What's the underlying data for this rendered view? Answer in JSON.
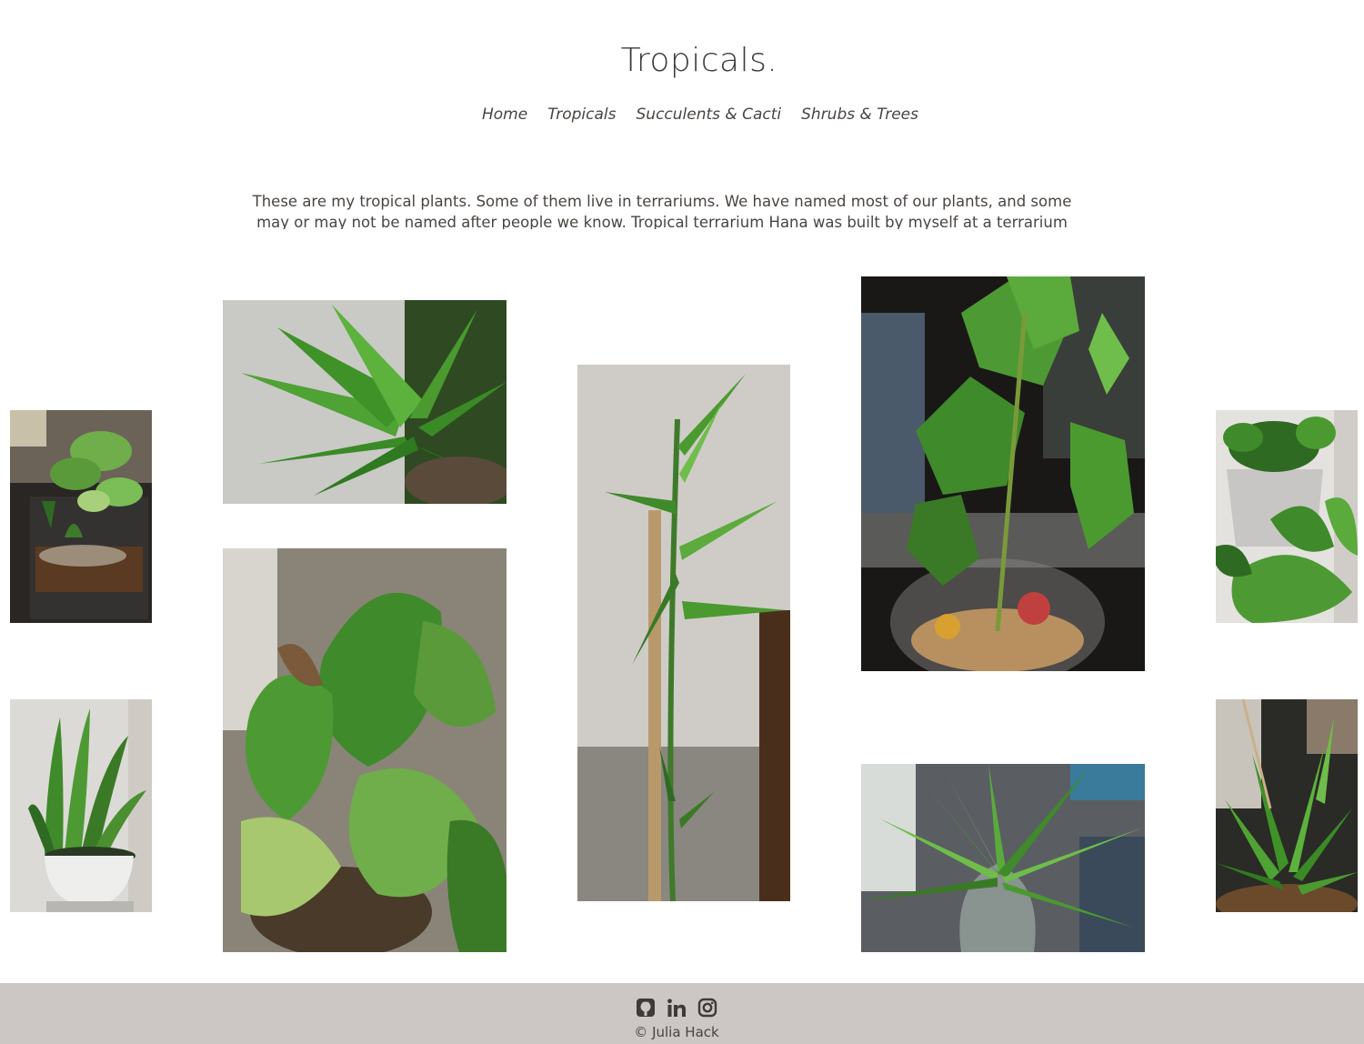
{
  "site": {
    "title": "Tropicals."
  },
  "nav": {
    "items": [
      {
        "label": "Home"
      },
      {
        "label": "Tropicals"
      },
      {
        "label": "Succulents & Cacti"
      },
      {
        "label": "Shrubs & Trees"
      }
    ]
  },
  "intro": {
    "text": "These are my tropical plants. Some of them live in terrariums. We have named most of our plants, and some may or may not be named after people we know. Tropical terrarium Hana was built by myself at a terrarium workshop."
  },
  "gallery": {
    "photos": [
      {
        "subject": "terrarium-with-plants"
      },
      {
        "subject": "snake-plant-in-white-pot"
      },
      {
        "subject": "spiky-succulent-plant"
      },
      {
        "subject": "variegated-pothos-hanging-basket"
      },
      {
        "subject": "lucky-bamboo-with-stake"
      },
      {
        "subject": "ivy-in-glass-bowl"
      },
      {
        "subject": "spider-plant-in-glass-vase"
      },
      {
        "subject": "pothos-in-white-pot"
      },
      {
        "subject": "aloe-plants"
      }
    ]
  },
  "footer": {
    "social": [
      {
        "icon": "github-icon"
      },
      {
        "icon": "linkedin-icon"
      },
      {
        "icon": "instagram-icon"
      }
    ],
    "copyright": "© Julia Hack"
  },
  "colors": {
    "text": "#4a4440",
    "footer_bg": "#ccc7c4",
    "leaf_green": "#3f8a2a"
  }
}
